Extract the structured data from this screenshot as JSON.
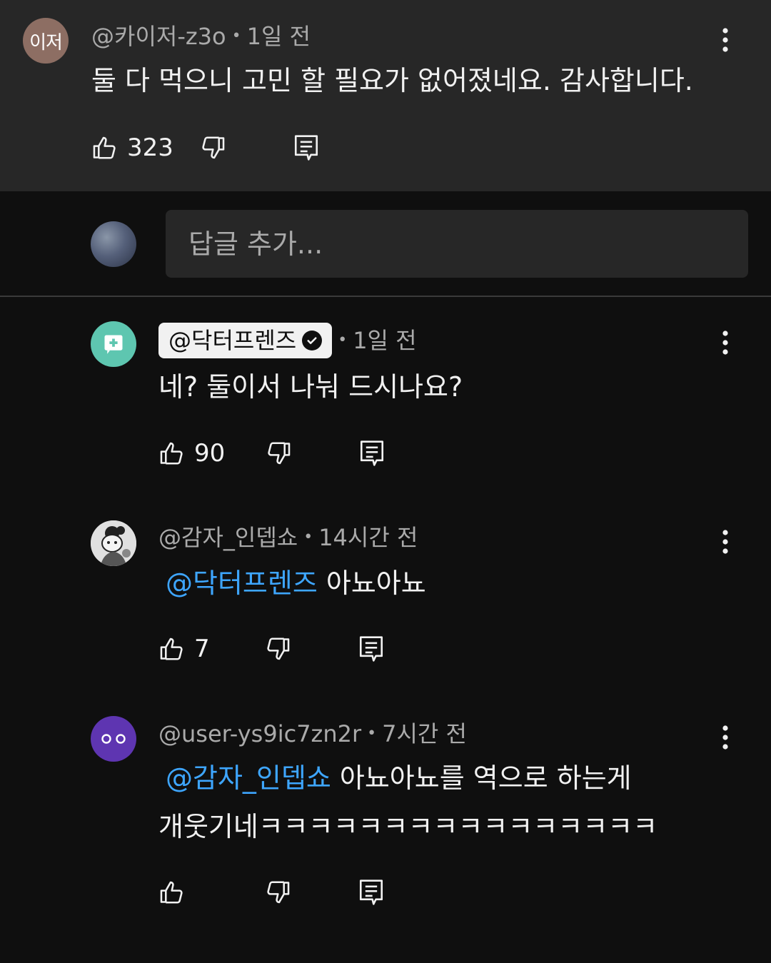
{
  "top_comment": {
    "avatar_text": "이저",
    "handle": "@카이저-z3o",
    "time": "1일 전",
    "text": "둘 다 먹으니 고민 할 필요가 없어졌네요. 감사합니다.",
    "likes": "323"
  },
  "reply_box": {
    "placeholder": "답글 추가..."
  },
  "replies": [
    {
      "handle": "@닥터프렌즈",
      "verified": true,
      "time": "1일 전",
      "text": "네? 둘이서 나눠 드시나요?",
      "likes": "90"
    },
    {
      "handle": "@감자_인뎁쇼",
      "time": "14시간 전",
      "mention": "@닥터프렌즈",
      "text": " 아뇨아뇨",
      "likes": "7"
    },
    {
      "handle": "@user-ys9ic7zn2r",
      "time": "7시간 전",
      "mention": "@감자_인뎁쇼",
      "text": " 아뇨아뇨를 역으로 하는게",
      "text_line2": "개웃기네ㅋㅋㅋㅋㅋㅋㅋㅋㅋㅋㅋㅋㅋㅋㅋㅋ",
      "likes": ""
    }
  ],
  "meta_separator": "•",
  "colors": {
    "background": "#0f0f0f",
    "highlight_background": "#272727",
    "mention": "#3ea6ff",
    "secondary_text": "#aaaaaa",
    "verified_avatar": "#5ec6b0",
    "purple_avatar": "#5e35b1",
    "avatar_initials_bg": "#8d6e63"
  },
  "icons": [
    "thumb-up-icon",
    "thumb-down-icon",
    "reply-icon",
    "more-vert-icon",
    "verified-check-icon"
  ]
}
